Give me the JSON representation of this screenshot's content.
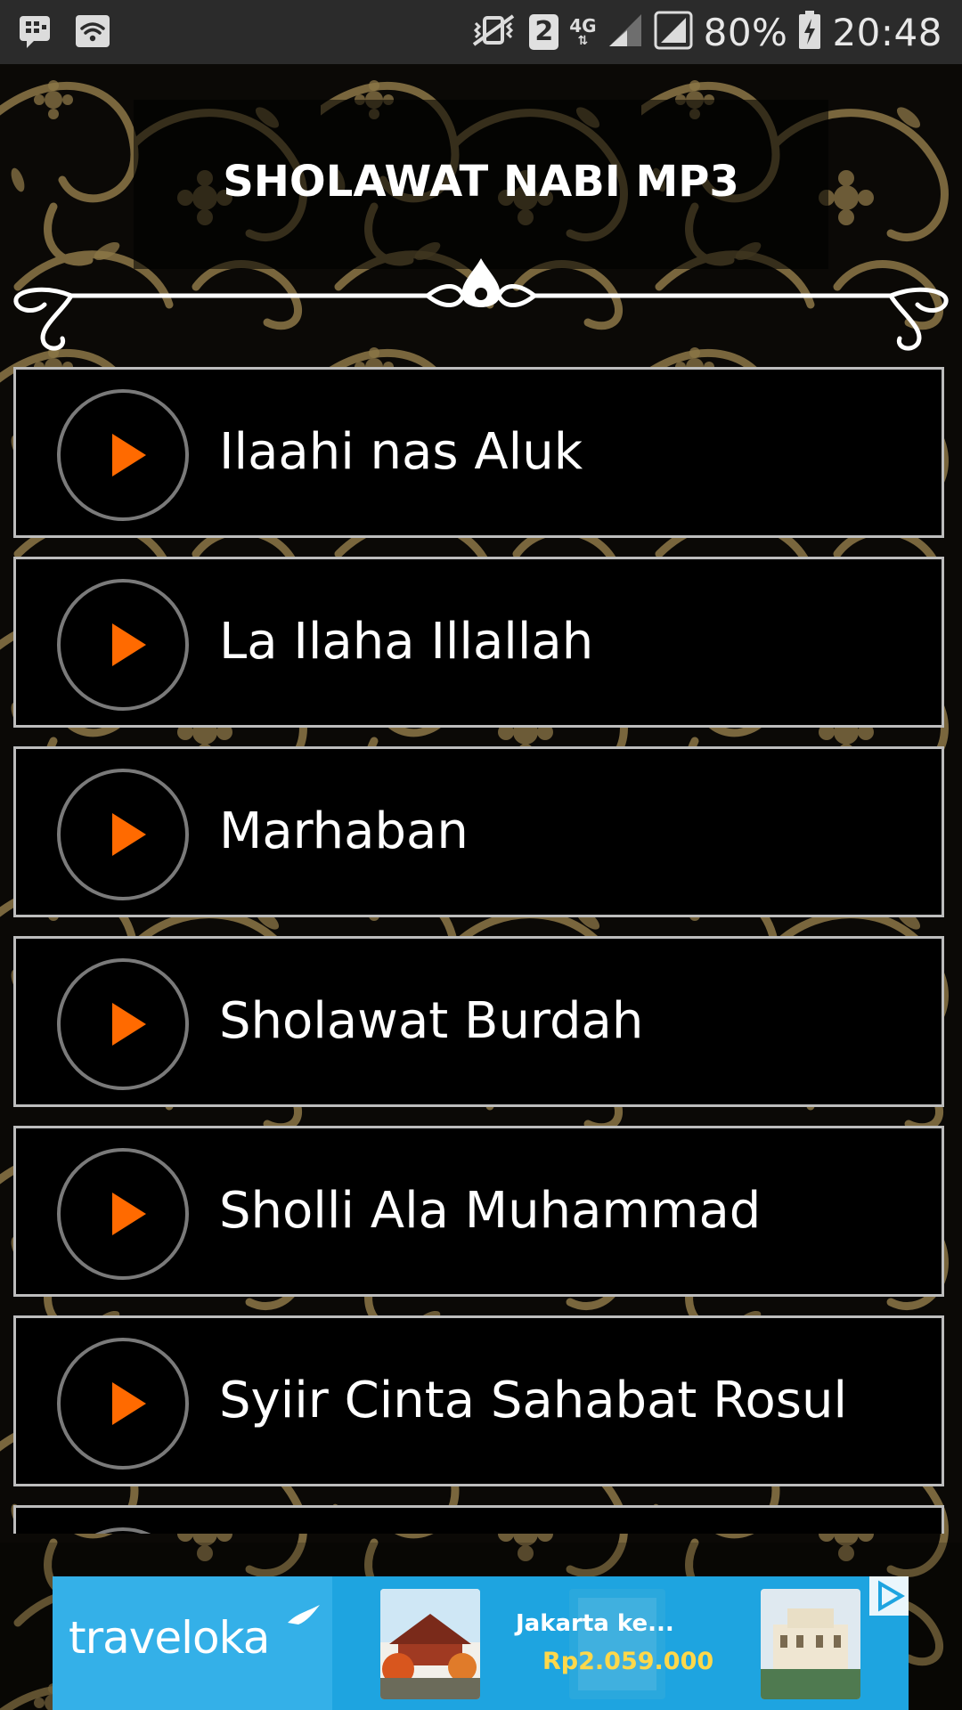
{
  "status_bar": {
    "sim_slot": "2",
    "network": "4G",
    "battery": "80%",
    "time": "20:48"
  },
  "app": {
    "title": "SHOLAWAT NABI MP3"
  },
  "tracks": [
    {
      "title": "Ilaahi nas Aluk"
    },
    {
      "title": "La Ilaha Illallah"
    },
    {
      "title": "Marhaban"
    },
    {
      "title": "Sholawat Burdah"
    },
    {
      "title": "Sholli Ala Muhammad"
    },
    {
      "title": "Syiir Cinta Sahabat Rosul"
    }
  ],
  "ad": {
    "brand": "traveloka",
    "route": "Jakarta ke...",
    "price": "Rp2.059.000"
  },
  "colors": {
    "accent": "#ff6a00",
    "gold": "#8a7440",
    "ad_blue": "#1ea4e0"
  }
}
